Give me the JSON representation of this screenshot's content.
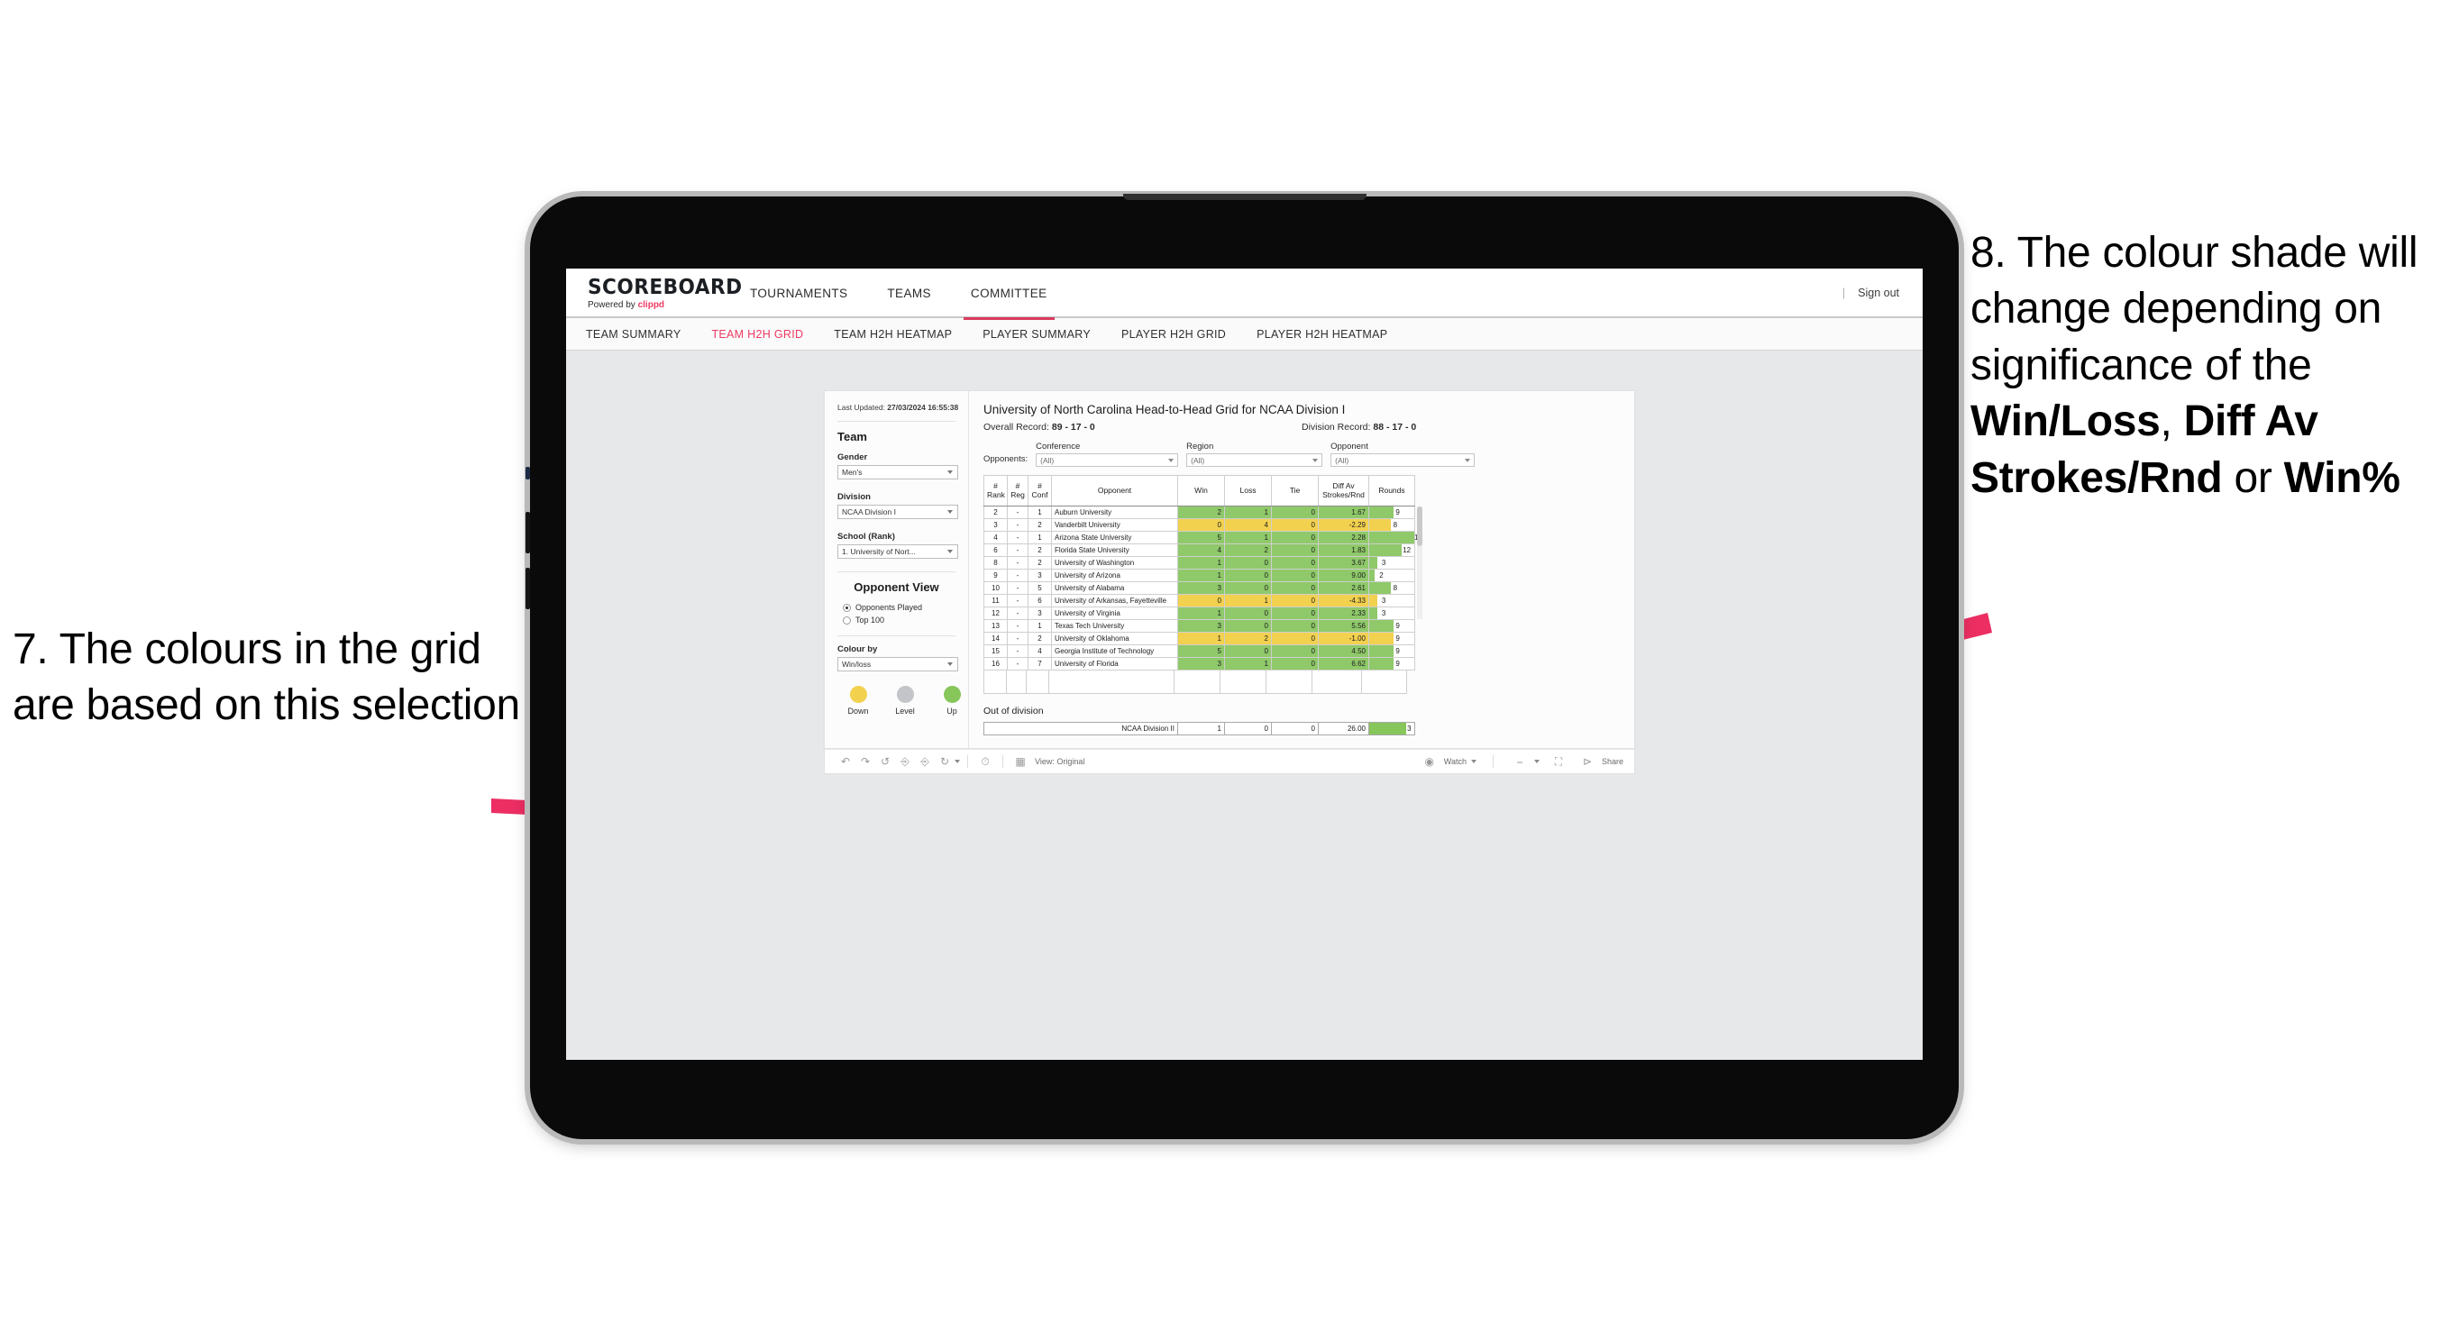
{
  "annotations": {
    "left": "7. The colours in the grid are based on this selection",
    "right_prefix": "8. The colour shade will change depending on significance of the ",
    "right_bold1": "Win/Loss",
    "right_mid1": ", ",
    "right_bold2": "Diff Av Strokes/Rnd",
    "right_mid2": " or ",
    "right_bold3": "Win%",
    "arrow_color": "#ec2e63"
  },
  "app": {
    "logo_main": "SCOREBOARD",
    "logo_sub_prefix": "Powered by ",
    "logo_brand": "clippd",
    "top_nav": [
      "TOURNAMENTS",
      "TEAMS",
      "COMMITTEE"
    ],
    "active_top_nav": "COMMITTEE",
    "sign_out": "Sign out",
    "divider": "|",
    "sub_nav": [
      "TEAM SUMMARY",
      "TEAM H2H GRID",
      "TEAM H2H HEATMAP",
      "PLAYER SUMMARY",
      "PLAYER H2H GRID",
      "PLAYER H2H HEATMAP"
    ],
    "active_sub_nav": "TEAM H2H GRID"
  },
  "panel": {
    "last_updated_label": "Last Updated: ",
    "last_updated_value": "27/03/2024 16:55:38",
    "team_heading": "Team",
    "gender_label": "Gender",
    "gender_value": "Men's",
    "division_label": "Division",
    "division_value": "NCAA Division I",
    "school_label": "School (Rank)",
    "school_value": "1. University of Nort...",
    "opponent_view_heading": "Opponent View",
    "radio_options": [
      {
        "label": "Opponents Played",
        "selected": true
      },
      {
        "label": "Top 100",
        "selected": false
      }
    ],
    "colour_by_label": "Colour by",
    "colour_by_value": "Win/loss",
    "legend": [
      {
        "label": "Down",
        "color": "#f2d14f"
      },
      {
        "label": "Level",
        "color": "#c3c5c9"
      },
      {
        "label": "Up",
        "color": "#86c65a"
      }
    ]
  },
  "viz": {
    "title": "University of North Carolina Head-to-Head Grid for NCAA Division I",
    "overall_record_label": "Overall Record: ",
    "overall_record_value": "89 - 17 - 0",
    "division_record_label": "Division Record: ",
    "division_record_value": "88 - 17 - 0",
    "opponents_label": "Opponents:",
    "filters": [
      {
        "label": "Conference",
        "value": "(All)"
      },
      {
        "label": "Region",
        "value": "(All)"
      },
      {
        "label": "Opponent",
        "value": "(All)"
      }
    ],
    "out_of_division_title": "Out of division",
    "out_of_division_row": {
      "name": "NCAA Division II",
      "win": "1",
      "loss": "0",
      "tie": "0",
      "diff": "26.00",
      "rounds": "3",
      "color": "#86c65a",
      "bar_pct": 82
    }
  },
  "chart_data": {
    "type": "table",
    "title": "University of North Carolina Head-to-Head Grid for NCAA Division I",
    "columns": [
      "# Rank",
      "# Reg",
      "# Conf",
      "Opponent",
      "Win",
      "Loss",
      "Tie",
      "Diff Av Strokes/Rnd",
      "Rounds"
    ],
    "colour_by": "Win/loss",
    "colour_scale": {
      "down": "#f2d14f",
      "level": "#c3c5c9",
      "up": "#86c65a"
    },
    "rounds_max": 17,
    "rows": [
      {
        "rank": "2",
        "reg": "-",
        "conf": "1",
        "opponent": "Auburn University",
        "win": "2",
        "loss": "1",
        "tie": "0",
        "diff": "1.67",
        "rounds": "9",
        "color": "#8fc96a",
        "bar_pct": 53
      },
      {
        "rank": "3",
        "reg": "-",
        "conf": "2",
        "opponent": "Vanderbilt University",
        "win": "0",
        "loss": "4",
        "tie": "0",
        "diff": "-2.29",
        "rounds": "8",
        "color": "#f2d14f",
        "bar_pct": 47
      },
      {
        "rank": "4",
        "reg": "-",
        "conf": "1",
        "opponent": "Arizona State University",
        "win": "5",
        "loss": "1",
        "tie": "0",
        "diff": "2.28",
        "rounds": "17",
        "color": "#8fc96a",
        "bar_pct": 100
      },
      {
        "rank": "6",
        "reg": "-",
        "conf": "2",
        "opponent": "Florida State University",
        "win": "4",
        "loss": "2",
        "tie": "0",
        "diff": "1.83",
        "rounds": "12",
        "color": "#8fc96a",
        "bar_pct": 71
      },
      {
        "rank": "8",
        "reg": "-",
        "conf": "2",
        "opponent": "University of Washington",
        "win": "1",
        "loss": "0",
        "tie": "0",
        "diff": "3.67",
        "rounds": "3",
        "color": "#8fc96a",
        "bar_pct": 18
      },
      {
        "rank": "9",
        "reg": "-",
        "conf": "3",
        "opponent": "University of Arizona",
        "win": "1",
        "loss": "0",
        "tie": "0",
        "diff": "9.00",
        "rounds": "2",
        "color": "#8fc96a",
        "bar_pct": 12
      },
      {
        "rank": "10",
        "reg": "-",
        "conf": "5",
        "opponent": "University of Alabama",
        "win": "3",
        "loss": "0",
        "tie": "0",
        "diff": "2.61",
        "rounds": "8",
        "color": "#8fc96a",
        "bar_pct": 47
      },
      {
        "rank": "11",
        "reg": "-",
        "conf": "6",
        "opponent": "University of Arkansas, Fayetteville",
        "win": "0",
        "loss": "1",
        "tie": "0",
        "diff": "-4.33",
        "rounds": "3",
        "color": "#f2d14f",
        "bar_pct": 18
      },
      {
        "rank": "12",
        "reg": "-",
        "conf": "3",
        "opponent": "University of Virginia",
        "win": "1",
        "loss": "0",
        "tie": "0",
        "diff": "2.33",
        "rounds": "3",
        "color": "#8fc96a",
        "bar_pct": 18
      },
      {
        "rank": "13",
        "reg": "-",
        "conf": "1",
        "opponent": "Texas Tech University",
        "win": "3",
        "loss": "0",
        "tie": "0",
        "diff": "5.56",
        "rounds": "9",
        "color": "#8fc96a",
        "bar_pct": 53
      },
      {
        "rank": "14",
        "reg": "-",
        "conf": "2",
        "opponent": "University of Oklahoma",
        "win": "1",
        "loss": "2",
        "tie": "0",
        "diff": "-1.00",
        "rounds": "9",
        "color": "#f2d14f",
        "bar_pct": 53
      },
      {
        "rank": "15",
        "reg": "-",
        "conf": "4",
        "opponent": "Georgia Institute of Technology",
        "win": "5",
        "loss": "0",
        "tie": "0",
        "diff": "4.50",
        "rounds": "9",
        "color": "#8fc96a",
        "bar_pct": 53
      },
      {
        "rank": "16",
        "reg": "-",
        "conf": "7",
        "opponent": "University of Florida",
        "win": "3",
        "loss": "1",
        "tie": "0",
        "diff": "6.62",
        "rounds": "9",
        "color": "#8fc96a",
        "bar_pct": 53
      }
    ]
  },
  "toolbar": {
    "view_label": "View: Original",
    "watch_label": "Watch",
    "share_label": "Share"
  }
}
